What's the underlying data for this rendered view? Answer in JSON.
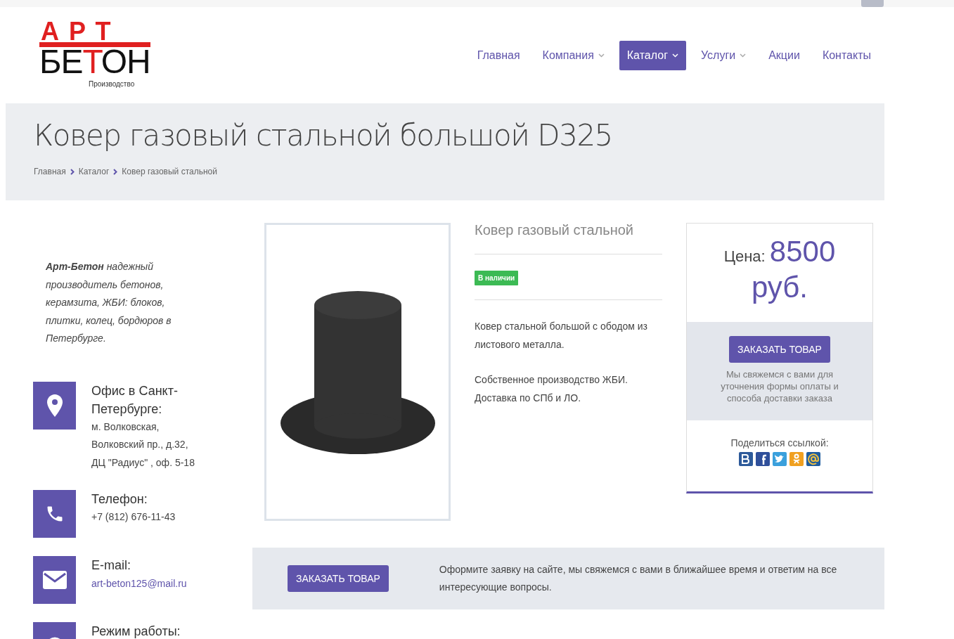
{
  "logo": {
    "top": "АРТ",
    "bottom": [
      {
        "text": "БЕ",
        "accent": false
      },
      {
        "text": "Т",
        "accent": true
      },
      {
        "text": "ОН",
        "accent": false
      }
    ],
    "tagline": "Производство"
  },
  "nav": [
    {
      "label": "Главная",
      "selected": false,
      "dropdown": false
    },
    {
      "label": "Компания",
      "selected": false,
      "dropdown": true
    },
    {
      "label": "Каталог",
      "selected": true,
      "dropdown": true
    },
    {
      "label": "Услуги",
      "selected": false,
      "dropdown": true
    },
    {
      "label": "Акции",
      "selected": false,
      "dropdown": false
    },
    {
      "label": "Контакты",
      "selected": false,
      "dropdown": false
    }
  ],
  "page_title": "Ковер газовый стальной большой D325",
  "breadcrumbs": [
    "Главная",
    "Каталог",
    "Ковер газовый стальной"
  ],
  "sidebar": {
    "about": "**Арт-Бетон** надежный производитель бетонов, керамзита, ЖБИ: блоков, плитки, колец, бордюров в Петербурге.",
    "contacts": [
      {
        "kind": "location",
        "title": "Офис в Санкт-Петербурге:",
        "lines": [
          "м. Волковская,",
          "Волковский пр., д.32,",
          "ДЦ \"Радиус\" , оф. 5-18"
        ]
      },
      {
        "kind": "phone",
        "title": "Телефон:",
        "lines": [
          "+7 (812) 676-11-43"
        ]
      },
      {
        "kind": "email",
        "title": "E-mail:",
        "lines": [
          "art-beton125@mail.ru"
        ]
      },
      {
        "kind": "clock",
        "title": "Режим работы:"
      }
    ]
  },
  "product": {
    "name": "Ковер газовый стальной",
    "stock": "В наличии",
    "in_stock": true,
    "description": [
      "Ковер стальной большой с ободом из листового металла.",
      "Собственное производство ЖБИ. Доставка по СПб и ЛО."
    ]
  },
  "price_card": {
    "label": "Цена:",
    "price": "8500 руб.",
    "order_button": "ЗАКАЗАТЬ ТОВАР",
    "note": "Мы свяжемся с вами для уточнения формы оплаты и способа доставки заказа",
    "share_label": "Поделиться ссылкой:",
    "share": [
      {
        "kind": "vk",
        "color": "#2d5a9a"
      },
      {
        "kind": "facebook",
        "color": "#2f4f9a"
      },
      {
        "kind": "twitter",
        "color": "#3aa0dc"
      },
      {
        "kind": "ok",
        "color": "#f0a020"
      },
      {
        "kind": "mail",
        "color": "#1f5c9e"
      }
    ]
  },
  "cta": {
    "button": "ЗАКАЗАТЬ ТОВАР",
    "text": "Оформите заявку на сайте, мы свяжемся с вами в ближайшее время и ответим на все интересующие вопросы."
  }
}
